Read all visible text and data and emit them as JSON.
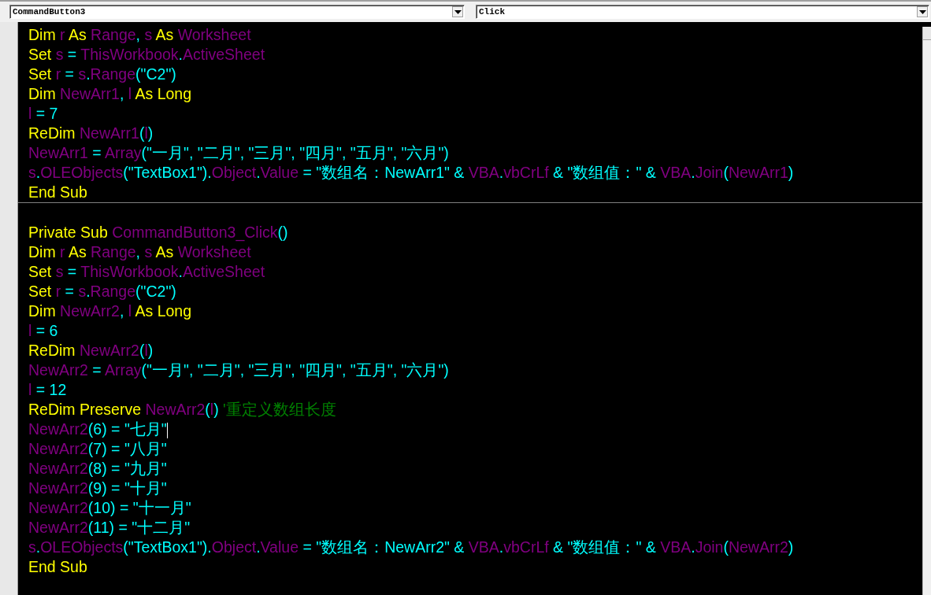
{
  "toolbar": {
    "object_box": {
      "value": "CommandButton3"
    },
    "procedure_box": {
      "value": "Click"
    }
  },
  "procedures": [
    {
      "lines": [
        [
          {
            "t": "Dim ",
            "kind": "keyword"
          },
          {
            "t": "r ",
            "kind": "ident"
          },
          {
            "t": "As ",
            "kind": "keyword"
          },
          {
            "t": "Range",
            "kind": "ident"
          },
          {
            "t": ", ",
            "kind": "op"
          },
          {
            "t": "s ",
            "kind": "ident"
          },
          {
            "t": "As ",
            "kind": "keyword"
          },
          {
            "t": "Worksheet",
            "kind": "ident"
          }
        ],
        [
          {
            "t": "Set ",
            "kind": "keyword"
          },
          {
            "t": "s ",
            "kind": "ident"
          },
          {
            "t": "= ",
            "kind": "op"
          },
          {
            "t": "ThisWorkbook",
            "kind": "ident"
          },
          {
            "t": ".",
            "kind": "op"
          },
          {
            "t": "ActiveSheet",
            "kind": "ident"
          }
        ],
        [
          {
            "t": "Set ",
            "kind": "keyword"
          },
          {
            "t": "r ",
            "kind": "ident"
          },
          {
            "t": "= ",
            "kind": "op"
          },
          {
            "t": "s",
            "kind": "ident"
          },
          {
            "t": ".",
            "kind": "op"
          },
          {
            "t": "Range",
            "kind": "ident"
          },
          {
            "t": "(\"C2\")",
            "kind": "op"
          }
        ],
        [
          {
            "t": "Dim ",
            "kind": "keyword"
          },
          {
            "t": "NewArr1",
            "kind": "ident"
          },
          {
            "t": ",",
            "kind": "op"
          },
          {
            "t": " l ",
            "kind": "ident"
          },
          {
            "t": "As Long",
            "kind": "keyword"
          }
        ],
        [
          {
            "t": "l ",
            "kind": "ident"
          },
          {
            "t": "= 7",
            "kind": "op"
          }
        ],
        [
          {
            "t": "ReDim ",
            "kind": "keyword"
          },
          {
            "t": "NewArr1",
            "kind": "ident"
          },
          {
            "t": "(",
            "kind": "op"
          },
          {
            "t": "l",
            "kind": "ident"
          },
          {
            "t": ")",
            "kind": "op"
          }
        ],
        [
          {
            "t": "NewArr1 ",
            "kind": "ident"
          },
          {
            "t": "= ",
            "kind": "op"
          },
          {
            "t": "Array",
            "kind": "ident"
          },
          {
            "t": "(\"一月\", \"二月\", \"三月\", \"四月\", \"五月\", \"六月\")",
            "kind": "op"
          }
        ],
        [
          {
            "t": "s",
            "kind": "ident"
          },
          {
            "t": ".",
            "kind": "op"
          },
          {
            "t": "OLEObjects",
            "kind": "ident"
          },
          {
            "t": "(\"TextBox1\").",
            "kind": "op"
          },
          {
            "t": "Object",
            "kind": "ident"
          },
          {
            "t": ".",
            "kind": "op"
          },
          {
            "t": "Value ",
            "kind": "ident"
          },
          {
            "t": "= \"数组名：NewArr1\" & ",
            "kind": "op"
          },
          {
            "t": "VBA",
            "kind": "ident"
          },
          {
            "t": ".",
            "kind": "op"
          },
          {
            "t": "vbCrLf ",
            "kind": "ident"
          },
          {
            "t": "& \"数组值：\" & ",
            "kind": "op"
          },
          {
            "t": "VBA",
            "kind": "ident"
          },
          {
            "t": ".",
            "kind": "op"
          },
          {
            "t": "Join",
            "kind": "ident"
          },
          {
            "t": "(",
            "kind": "op"
          },
          {
            "t": "NewArr1",
            "kind": "ident"
          },
          {
            "t": ")",
            "kind": "op"
          }
        ],
        [
          {
            "t": "End Sub",
            "kind": "keyword"
          }
        ]
      ]
    },
    {
      "lines": [
        [
          {
            "t": "Private Sub ",
            "kind": "keyword"
          },
          {
            "t": "CommandButton3_Click",
            "kind": "ident"
          },
          {
            "t": "()",
            "kind": "op"
          }
        ],
        [
          {
            "t": "Dim ",
            "kind": "keyword"
          },
          {
            "t": "r ",
            "kind": "ident"
          },
          {
            "t": "As ",
            "kind": "keyword"
          },
          {
            "t": "Range",
            "kind": "ident"
          },
          {
            "t": ", ",
            "kind": "op"
          },
          {
            "t": "s ",
            "kind": "ident"
          },
          {
            "t": "As ",
            "kind": "keyword"
          },
          {
            "t": "Worksheet",
            "kind": "ident"
          }
        ],
        [
          {
            "t": "Set ",
            "kind": "keyword"
          },
          {
            "t": "s ",
            "kind": "ident"
          },
          {
            "t": "= ",
            "kind": "op"
          },
          {
            "t": "ThisWorkbook",
            "kind": "ident"
          },
          {
            "t": ".",
            "kind": "op"
          },
          {
            "t": "ActiveSheet",
            "kind": "ident"
          }
        ],
        [
          {
            "t": "Set ",
            "kind": "keyword"
          },
          {
            "t": "r ",
            "kind": "ident"
          },
          {
            "t": "= ",
            "kind": "op"
          },
          {
            "t": "s",
            "kind": "ident"
          },
          {
            "t": ".",
            "kind": "op"
          },
          {
            "t": "Range",
            "kind": "ident"
          },
          {
            "t": "(\"C2\")",
            "kind": "op"
          }
        ],
        [
          {
            "t": "Dim ",
            "kind": "keyword"
          },
          {
            "t": "NewArr2",
            "kind": "ident"
          },
          {
            "t": ",",
            "kind": "op"
          },
          {
            "t": " l ",
            "kind": "ident"
          },
          {
            "t": "As Long",
            "kind": "keyword"
          }
        ],
        [
          {
            "t": "l ",
            "kind": "ident"
          },
          {
            "t": "= 6",
            "kind": "op"
          }
        ],
        [
          {
            "t": "ReDim ",
            "kind": "keyword"
          },
          {
            "t": "NewArr2",
            "kind": "ident"
          },
          {
            "t": "(",
            "kind": "op"
          },
          {
            "t": "l",
            "kind": "ident"
          },
          {
            "t": ")",
            "kind": "op"
          }
        ],
        [
          {
            "t": "NewArr2 ",
            "kind": "ident"
          },
          {
            "t": "= ",
            "kind": "op"
          },
          {
            "t": "Array",
            "kind": "ident"
          },
          {
            "t": "(\"一月\", \"二月\", \"三月\", \"四月\", \"五月\", \"六月\")",
            "kind": "op"
          }
        ],
        [
          {
            "t": "l ",
            "kind": "ident"
          },
          {
            "t": "= 12",
            "kind": "op"
          }
        ],
        [
          {
            "t": "ReDim Preserve ",
            "kind": "keyword"
          },
          {
            "t": "NewArr2",
            "kind": "ident"
          },
          {
            "t": "(",
            "kind": "op"
          },
          {
            "t": "l",
            "kind": "ident"
          },
          {
            "t": ") ",
            "kind": "op"
          },
          {
            "t": "'重定义数组长度",
            "kind": "comment"
          }
        ],
        [
          {
            "t": "NewArr2",
            "kind": "ident"
          },
          {
            "t": "(6) = \"七月\"",
            "kind": "op",
            "caret": true
          }
        ],
        [
          {
            "t": "NewArr2",
            "kind": "ident"
          },
          {
            "t": "(7) = \"八月\"",
            "kind": "op"
          }
        ],
        [
          {
            "t": "NewArr2",
            "kind": "ident"
          },
          {
            "t": "(8) = \"九月\"",
            "kind": "op"
          }
        ],
        [
          {
            "t": "NewArr2",
            "kind": "ident"
          },
          {
            "t": "(9) = \"十月\"",
            "kind": "op"
          }
        ],
        [
          {
            "t": "NewArr2",
            "kind": "ident"
          },
          {
            "t": "(10) = \"十一月\"",
            "kind": "op"
          }
        ],
        [
          {
            "t": "NewArr2",
            "kind": "ident"
          },
          {
            "t": "(11) = \"十二月\"",
            "kind": "op"
          }
        ],
        [
          {
            "t": "s",
            "kind": "ident"
          },
          {
            "t": ".",
            "kind": "op"
          },
          {
            "t": "OLEObjects",
            "kind": "ident"
          },
          {
            "t": "(\"TextBox1\").",
            "kind": "op"
          },
          {
            "t": "Object",
            "kind": "ident"
          },
          {
            "t": ".",
            "kind": "op"
          },
          {
            "t": "Value ",
            "kind": "ident"
          },
          {
            "t": "= \"数组名：NewArr2\" & ",
            "kind": "op"
          },
          {
            "t": "VBA",
            "kind": "ident"
          },
          {
            "t": ".",
            "kind": "op"
          },
          {
            "t": "vbCrLf ",
            "kind": "ident"
          },
          {
            "t": "& \"数组值：\" & ",
            "kind": "op"
          },
          {
            "t": "VBA",
            "kind": "ident"
          },
          {
            "t": ".",
            "kind": "op"
          },
          {
            "t": "Join",
            "kind": "ident"
          },
          {
            "t": "(",
            "kind": "op"
          },
          {
            "t": "NewArr2",
            "kind": "ident"
          },
          {
            "t": ")",
            "kind": "op"
          }
        ],
        [
          {
            "t": "End Sub",
            "kind": "keyword"
          }
        ]
      ]
    }
  ]
}
